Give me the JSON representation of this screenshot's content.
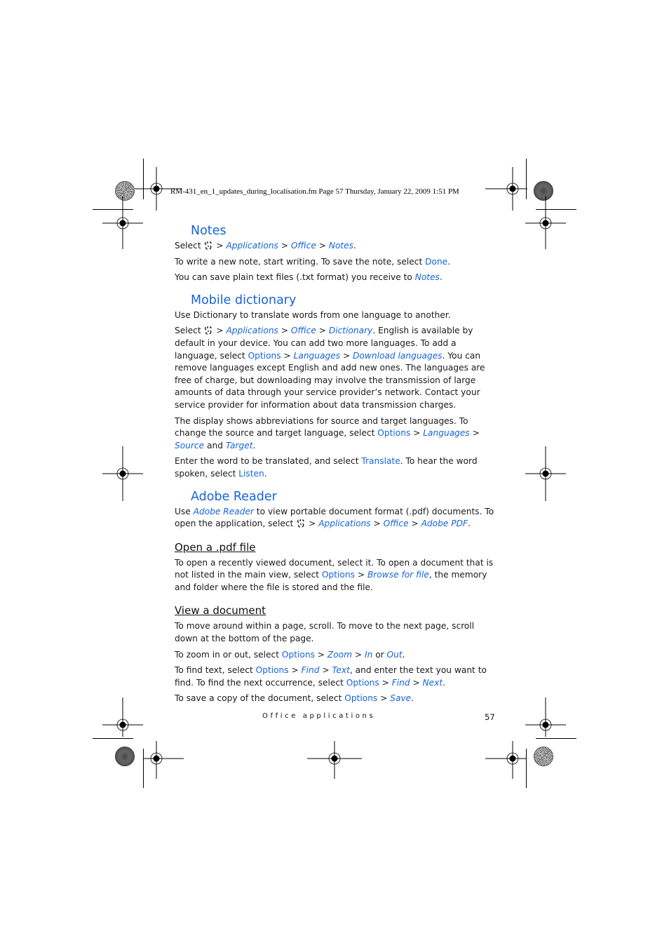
{
  "slug": "RM-431_en_1_updates_during_localisation.fm  Page 57  Thursday, January 22, 2009  1:51 PM",
  "sections": {
    "notes": {
      "title": "Notes",
      "p1": {
        "pre": "Select",
        "a": "Applications",
        "b": "Office",
        "c": "Notes",
        "sep": ">",
        "end": "."
      },
      "p2": {
        "pre": "To write a new note, start writing. To save the note, select ",
        "cmd": "Done",
        "end": "."
      },
      "p3": {
        "pre": "You can save plain text files (.txt format) you receive to ",
        "nav": "Notes",
        "end": "."
      }
    },
    "dictionary": {
      "title": "Mobile dictionary",
      "p1": "Use Dictionary to translate words from one language to another.",
      "p2": {
        "pre": "Select",
        "a": "Applications",
        "b": "Office",
        "c": "Dictionary",
        "mid": ". English is available by default in your device. You can add two more languages. To add a language, select ",
        "cmd": "Options",
        "d": "Languages",
        "e": "Download languages",
        "end": ". You can remove languages except English and add new ones. The languages are free of charge, but downloading may involve the transmission of large amounts of data through your service provider’s network. Contact your service provider for information about data transmission charges."
      },
      "p3": {
        "pre": "The display shows abbreviations for source and target languages. To change the source and target language, select ",
        "cmd": "Options",
        "a": "Languages",
        "b": "Source",
        "and": " and ",
        "c": "Target",
        "end": "."
      },
      "p4": {
        "pre": "Enter the word to be translated, and select ",
        "cmd1": "Translate",
        "mid": ". To hear the word spoken, select ",
        "cmd2": "Listen",
        "end": "."
      }
    },
    "adobe": {
      "title": "Adobe Reader",
      "p1": {
        "pre": "Use ",
        "nav1": "Adobe Reader",
        "mid": " to view portable document format (.pdf) documents. To open the application, select",
        "a": "Applications",
        "b": "Office",
        "c": "Adobe PDF",
        "end": "."
      },
      "open": {
        "title": "Open a .pdf file",
        "p1": {
          "pre": "To open a recently viewed document, select it. To open a document that is not listed in the main view, select ",
          "cmd": "Options",
          "nav": "Browse for file",
          "end": ", the memory and folder where the file is stored and the file."
        }
      },
      "view": {
        "title": "View a document",
        "p1": "To move around within a page, scroll. To move to the next page, scroll down at the bottom of the page.",
        "p2": {
          "pre": "To zoom in or out, select ",
          "cmd": "Options",
          "a": "Zoom",
          "b": "In",
          "or": " or ",
          "c": "Out",
          "end": "."
        },
        "p3": {
          "pre": "To find text, select ",
          "cmd1": "Options",
          "a": "Find",
          "b": "Text",
          "mid": ", and enter the text you want to find. To find the next occurrence, select ",
          "cmd2": "Options",
          "c": "Find",
          "d": "Next",
          "end": "."
        },
        "p4": {
          "pre": "To save a copy of the document, select ",
          "cmd": "Options",
          "a": "Save",
          "end": "."
        }
      }
    }
  },
  "footer": {
    "chapter": "Office applications",
    "page": "57"
  },
  "icons": {
    "menu": "menu-key-icon",
    "registration": "registration-mark-icon",
    "color_bar": "star-target-icon"
  },
  "colors": {
    "accent": "#1464d8",
    "text": "#1a1a1a"
  }
}
